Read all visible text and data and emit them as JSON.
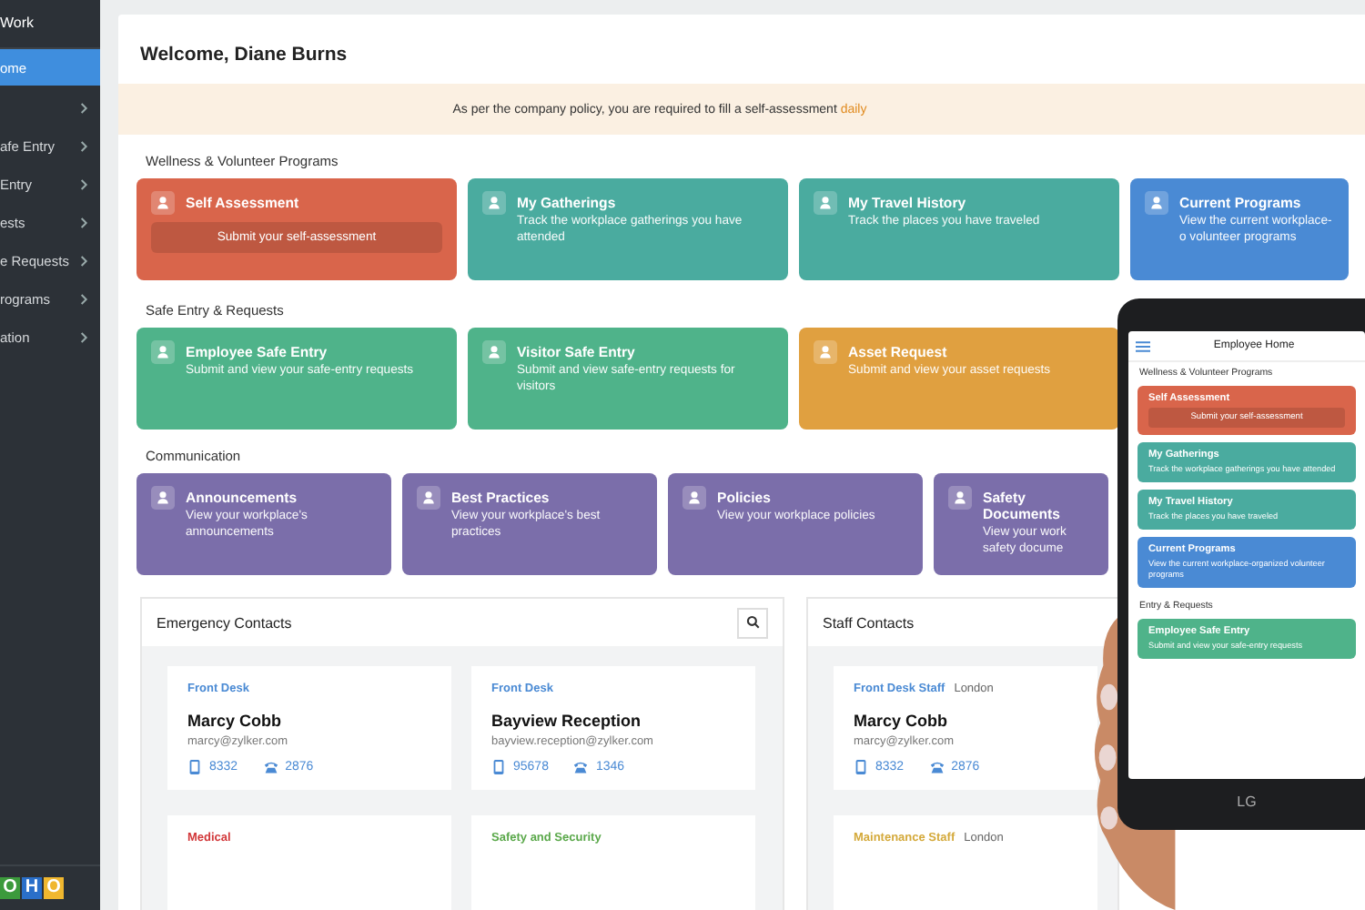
{
  "sidebar": {
    "title": "Work",
    "items": [
      {
        "label": "ome",
        "selected": true,
        "submenu": false
      },
      {
        "selected": false,
        "submenu": true
      },
      {
        "label": "afe Entry",
        "selected": false,
        "submenu": true
      },
      {
        "label": "Entry",
        "selected": false,
        "submenu": true
      },
      {
        "label": "ests",
        "selected": false,
        "submenu": true
      },
      {
        "label": "e Requests",
        "selected": false,
        "submenu": true
      },
      {
        "label": "rograms",
        "selected": false,
        "submenu": true
      },
      {
        "label": "ation",
        "selected": false,
        "submenu": true
      }
    ],
    "logo": [
      {
        "char": "O",
        "color": "#3c9a3c"
      },
      {
        "char": "H",
        "color": "#2a6fc9"
      },
      {
        "char": "O",
        "color": "#f0b72f"
      }
    ]
  },
  "header": {
    "title": "Welcome, Diane Burns"
  },
  "banner": {
    "text": "As per the company policy, you are required to fill a self-assessment",
    "highlight": "daily"
  },
  "sections": [
    {
      "title": "Wellness & Volunteer Programs",
      "cards": [
        {
          "title": "Self Assessment",
          "action": "Submit your self-assessment",
          "color": "#d9654b"
        },
        {
          "title": "My Gatherings",
          "description": "Track the workplace gatherings you have attended",
          "color": "#4aab9f"
        },
        {
          "title": "My Travel History",
          "description": "Track the places you have traveled",
          "color": "#4aab9f"
        },
        {
          "title": "Current Programs",
          "description": "View the current workplace-o volunteer programs",
          "color": "#4a8ad4"
        }
      ]
    },
    {
      "title": "Safe Entry & Requests",
      "cards": [
        {
          "title": "Employee Safe Entry",
          "description": "Submit and view your safe-entry requests",
          "color": "#4fb38a"
        },
        {
          "title": "Visitor Safe Entry",
          "description": "Submit and view safe-entry requests for visitors",
          "color": "#4fb38a"
        },
        {
          "title": "Asset Request",
          "description": "Submit and view your asset requests",
          "color": "#e0a040"
        }
      ]
    },
    {
      "title": "Communication",
      "cards": [
        {
          "title": "Announcements",
          "description": "View your workplace's announcements",
          "color": "#7b6eaa"
        },
        {
          "title": "Best Practices",
          "description": "View your workplace's best practices",
          "color": "#7b6eaa"
        },
        {
          "title": "Policies",
          "description": "View your workplace policies",
          "color": "#7b6eaa"
        },
        {
          "title": "Safety Documents",
          "description": "View your work safety docume",
          "color": "#7b6eaa"
        }
      ]
    }
  ],
  "emergency_contacts": {
    "title": "Emergency Contacts",
    "cards": [
      {
        "role": "Front Desk",
        "color": "#4a8ad4",
        "name": "Marcy Cobb",
        "email": "marcy@zylker.com",
        "mobile": "8332",
        "phone": "2876"
      },
      {
        "role": "Front Desk",
        "color": "#4a8ad4",
        "name": "Bayview Reception",
        "email": "bayview.reception@zylker.com",
        "mobile": "95678",
        "phone": "1346"
      },
      {
        "role": "Medical",
        "color": "#d2383a"
      },
      {
        "role": "Safety and Security",
        "color": "#5aa84a"
      }
    ]
  },
  "staff_contacts": {
    "title": "Staff Contacts",
    "cards": [
      {
        "role": "Front Desk Staff",
        "color": "#4a8ad4",
        "location": "London",
        "name": "Marcy Cobb",
        "email": "marcy@zylker.com",
        "mobile": "8332",
        "phone": "2876"
      },
      {
        "role": "Maintenance Staff",
        "color": "#d4a93a",
        "location": "London"
      }
    ]
  },
  "phone": {
    "title": "Employee Home",
    "brand": "LG",
    "items": [
      {
        "kind": "section",
        "title": "Wellness & Volunteer Programs"
      },
      {
        "kind": "card",
        "title": "Self Assessment",
        "action": "Submit your self-assessment",
        "color": "#d9654b"
      },
      {
        "kind": "card",
        "title": "My Gatherings",
        "description": "Track the workplace gatherings you have attended",
        "color": "#4aab9f"
      },
      {
        "kind": "card",
        "title": "My Travel History",
        "description": "Track the places you have traveled",
        "color": "#4aab9f"
      },
      {
        "kind": "card",
        "title": "Current Programs",
        "description": "View the current workplace-organized volunteer programs",
        "color": "#4a8ad4"
      },
      {
        "kind": "section",
        "title": "Entry & Requests"
      },
      {
        "kind": "card",
        "title": "Employee Safe Entry",
        "description": "Submit and view your safe-entry requests",
        "color": "#4fb38a"
      }
    ]
  }
}
